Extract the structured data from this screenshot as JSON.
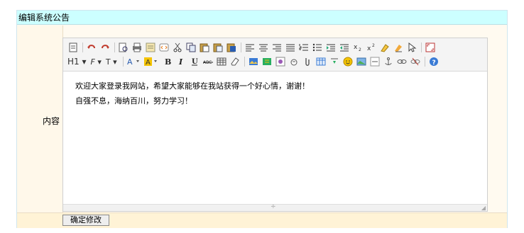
{
  "panel": {
    "title": "编辑系统公告",
    "field_label": "内容",
    "submit_label": "确定修改"
  },
  "editor": {
    "toolbar": {
      "heading_label": "H1",
      "font_family_label": "F",
      "font_size_label": "T"
    },
    "content_lines": [
      "欢迎大家登录我网站，希望大家能够在我站获得一个好心情，谢谢！",
      "自强不息，海纳百川，努力学习！"
    ]
  },
  "colors": {
    "title_bg": "#ccffff",
    "frame_bg": "#fffaf0"
  }
}
